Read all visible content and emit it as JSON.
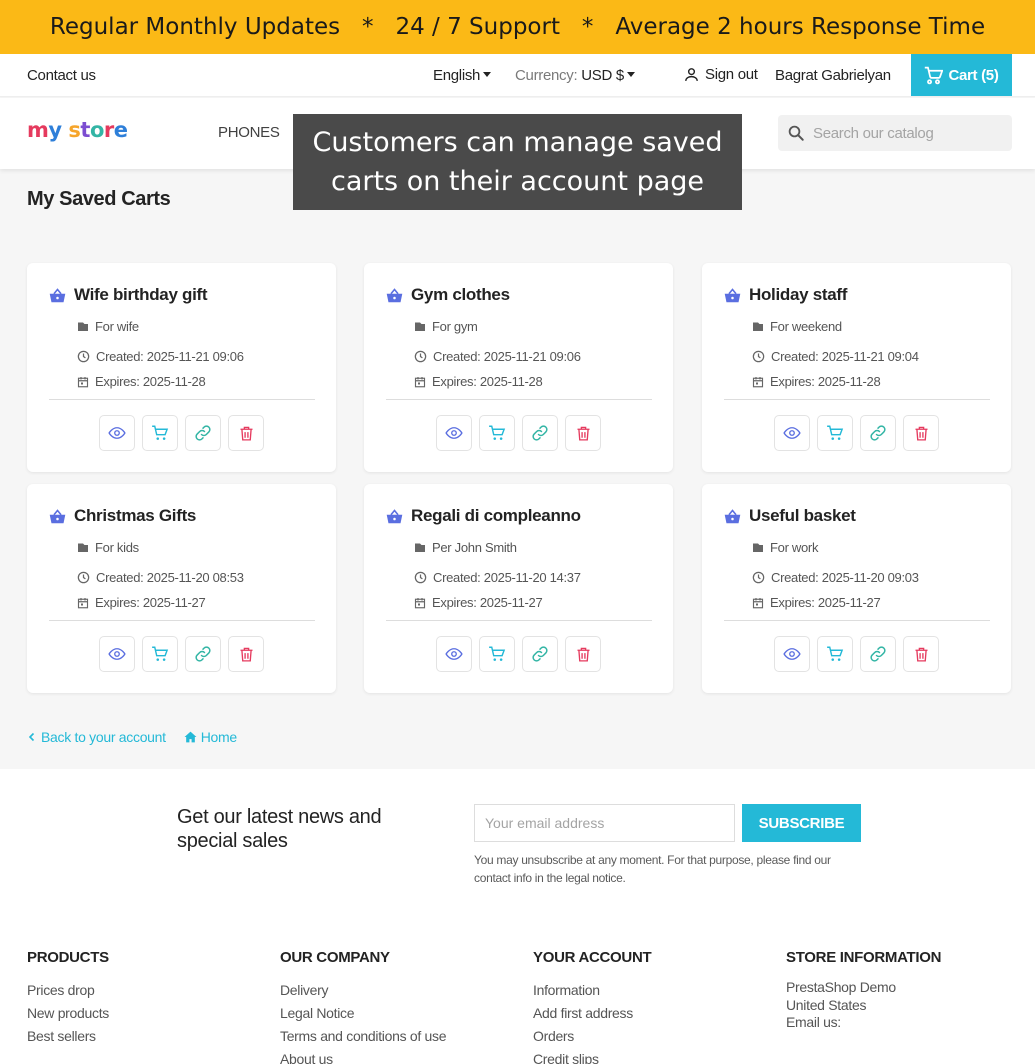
{
  "banner": {
    "text": "Regular Monthly Updates   *   24 / 7 Support   *   Average 2 hours Response Time"
  },
  "topbar": {
    "contact": "Contact us",
    "language": "English",
    "currency_label": "Currency:",
    "currency_value": "USD $",
    "sign_out": "Sign out",
    "user_name": "Bagrat Gabrielyan",
    "cart": "Cart (5)"
  },
  "header": {
    "logo": "my store",
    "nav_phones": "PHONES",
    "search_placeholder": "Search our catalog"
  },
  "tooltip": {
    "line1": "Customers can manage saved",
    "line2": "carts on their account page"
  },
  "page": {
    "title": "My Saved Carts"
  },
  "carts": [
    {
      "name": "Wife birthday gift",
      "note": "For wife",
      "created": "Created: 2025-11-21 09:06",
      "expires": "Expires: 2025-11-28"
    },
    {
      "name": "Gym clothes",
      "note": "For gym",
      "created": "Created: 2025-11-21 09:06",
      "expires": "Expires: 2025-11-28"
    },
    {
      "name": "Holiday staff",
      "note": "For weekend",
      "created": "Created: 2025-11-21 09:04",
      "expires": "Expires: 2025-11-28"
    },
    {
      "name": "Christmas Gifts",
      "note": "For kids",
      "created": "Created: 2025-11-20 08:53",
      "expires": "Expires: 2025-11-27"
    },
    {
      "name": "Regali di compleanno",
      "note": "Per John Smith",
      "created": "Created: 2025-11-20 14:37",
      "expires": "Expires: 2025-11-27"
    },
    {
      "name": "Useful basket",
      "note": "For work",
      "created": "Created: 2025-11-20 09:03",
      "expires": "Expires: 2025-11-27"
    }
  ],
  "links": {
    "back": "Back to your account",
    "home": "Home"
  },
  "newsletter": {
    "title": "Get our latest news and special sales",
    "placeholder": "Your email address",
    "button": "SUBSCRIBE",
    "note": "You may unsubscribe at any moment. For that purpose, please find our contact info in the legal notice."
  },
  "footer": {
    "products": {
      "heading": "PRODUCTS",
      "items": [
        "Prices drop",
        "New products",
        "Best sellers"
      ]
    },
    "company": {
      "heading": "OUR COMPANY",
      "items": [
        "Delivery",
        "Legal Notice",
        "Terms and conditions of use",
        "About us"
      ]
    },
    "account": {
      "heading": "YOUR ACCOUNT",
      "items": [
        "Information",
        "Add first address",
        "Orders",
        "Credit slips"
      ]
    },
    "store": {
      "heading": "STORE INFORMATION",
      "lines": [
        "PrestaShop Demo",
        "United States",
        "Email us:"
      ]
    }
  },
  "colors": {
    "banner": "#fbb916",
    "accent": "#24b9d7",
    "danger": "#e53a5e",
    "basket_icon": "#5a6ee0"
  }
}
